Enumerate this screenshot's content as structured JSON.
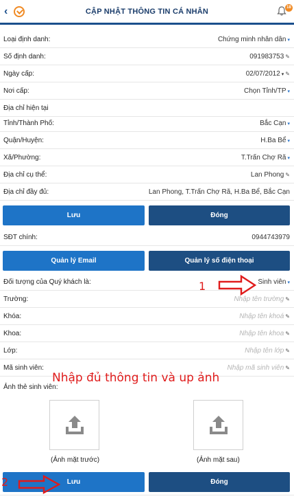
{
  "header": {
    "title": "CẬP NHẬT THÔNG TIN CÁ NHÂN",
    "badge": "18"
  },
  "fields": [
    {
      "label": "Loại định danh:",
      "value": "Chứng minh nhân dân",
      "control": "dropdown"
    },
    {
      "label": "Số định danh:",
      "value": "091983753",
      "control": "edit"
    },
    {
      "label": "Ngày cấp:",
      "value": "02/07/2012",
      "control": "date"
    },
    {
      "label": "Nơi cấp:",
      "value": "Chọn Tỉnh/TP",
      "control": "dropdown"
    }
  ],
  "address": {
    "section_label": "Địa chỉ hiện tại",
    "province": {
      "label": "Tỉnh/Thành Phố:",
      "value": "Bắc Cạn"
    },
    "district": {
      "label": "Quận/Huyện:",
      "value": "H.Ba Bể"
    },
    "ward": {
      "label": "Xã/Phường:",
      "value": "T.Trấn Chợ Rã"
    },
    "street": {
      "label": "Địa chỉ cụ thể:",
      "value": "Lan Phong"
    },
    "full": {
      "label": "Địa chỉ đầy đủ:",
      "value": "Lan Phong, T.Trấn Chợ Rã, H.Ba Bể, Bắc Cạn"
    }
  },
  "buttons1": {
    "save": "Lưu",
    "close": "Đóng"
  },
  "phone": {
    "label": "SĐT chính:",
    "value": "0944743979"
  },
  "manage": {
    "email": "Quản lý Email",
    "phone": "Quản lý số điện thoại"
  },
  "customer": {
    "label": "Đối tượng của Quý khách là:",
    "value": "Sinh viên"
  },
  "student": [
    {
      "label": "Trường:",
      "placeholder": "Nhập tên trường"
    },
    {
      "label": "Khóa:",
      "placeholder": "Nhập tên khoá"
    },
    {
      "label": "Khoa:",
      "placeholder": "Nhập tên khoa"
    },
    {
      "label": "Lớp:",
      "placeholder": "Nhập tên lớp"
    },
    {
      "label": "Mã sinh viên:",
      "placeholder": "Nhập mã sinh viên"
    }
  ],
  "card": {
    "label": "Ảnh thẻ sinh viên:",
    "front": "(Ảnh mặt trước)",
    "back": "(Ảnh mặt sau)"
  },
  "buttons2": {
    "save": "Lưu",
    "close": "Đóng"
  },
  "annotations": {
    "num1": "1",
    "num2": "2",
    "note": "Nhập đủ thông tin và up ảnh",
    "color": "#e01b1b"
  },
  "colors": {
    "primary": "#1e74c7",
    "dark": "#1d4e82",
    "accent": "#f08a24"
  },
  "icons": [
    "back-icon",
    "app-logo-icon",
    "bell-icon",
    "pencil-icon",
    "dropdown-caret-icon",
    "upload-icon",
    "arrow-icon"
  ]
}
